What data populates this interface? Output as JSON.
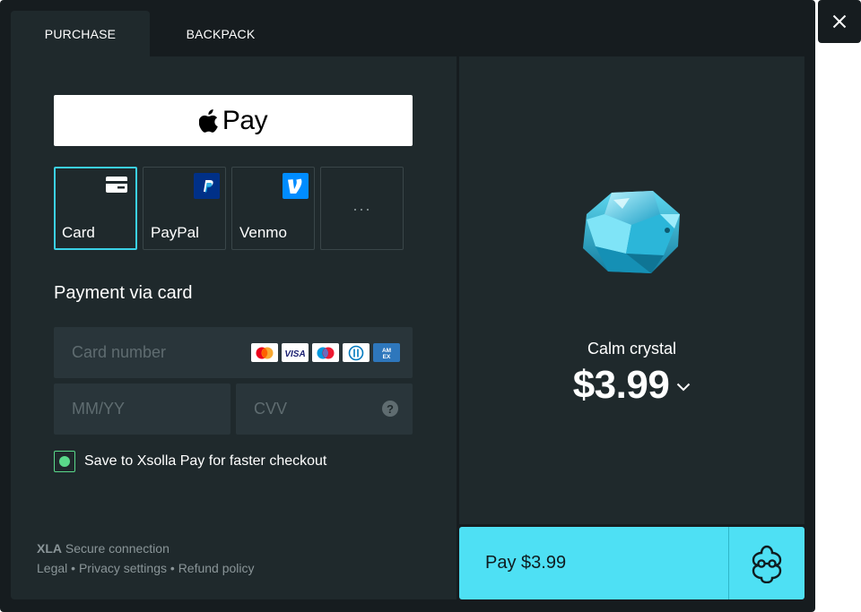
{
  "tabs": [
    {
      "label": "PURCHASE",
      "active": true
    },
    {
      "label": "BACKPACK",
      "active": false
    }
  ],
  "apple_pay": {
    "label": "Pay",
    "icon": "apple-icon"
  },
  "payment_methods": [
    {
      "label": "Card",
      "icon": "card-icon",
      "selected": true
    },
    {
      "label": "PayPal",
      "icon": "paypal-icon",
      "selected": false
    },
    {
      "label": "Venmo",
      "icon": "venmo-icon",
      "selected": false
    },
    {
      "label": "···",
      "icon": "more-icon",
      "selected": false
    }
  ],
  "card_form": {
    "title": "Payment via card",
    "card_number_placeholder": "Card number",
    "card_number_value": "",
    "expiry_placeholder": "MM/YY",
    "expiry_value": "",
    "cvv_placeholder": "CVV",
    "cvv_value": "",
    "brands": [
      "mastercard",
      "visa",
      "maestro",
      "diners",
      "amex"
    ],
    "save_checkbox_label": "Save to Xsolla Pay for faster checkout",
    "save_checked": true
  },
  "footer": {
    "secure_brand": "XLA",
    "secure_text": "Secure connection",
    "links": [
      "Legal",
      "Privacy settings",
      "Refund policy"
    ],
    "separator": "•"
  },
  "item": {
    "name": "Calm crystal",
    "price": "$3.99",
    "image": "crystal-gem"
  },
  "pay_button": {
    "label": "Pay $3.99"
  },
  "colors": {
    "accent": "#4ee0f4",
    "selected_border": "#3bd1e6",
    "checkbox": "#5ad98a",
    "panel": "#1f292c",
    "background": "#161c1f"
  }
}
